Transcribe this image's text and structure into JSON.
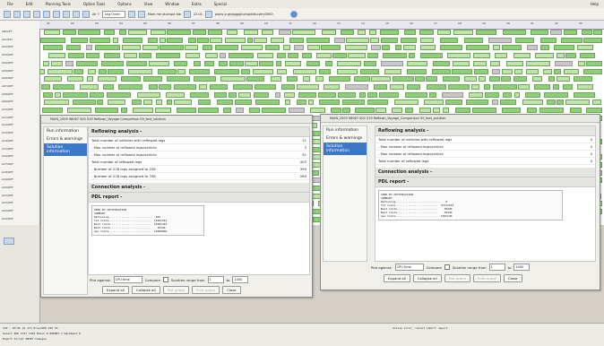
{
  "menu": [
    "File",
    "Edit",
    "Planning Tools",
    "Option Tools",
    "Options",
    "View",
    "Window",
    "Extra",
    "Special",
    "Help"
  ],
  "toolbar": {
    "zoom_label": "Air ?",
    "pairing_label": "Leg Order",
    "sel1": "Mark me ptunspd ble",
    "date_label": "22.01",
    "version_label": "plans p grpsgg/ptunspddd.com/0000"
  },
  "rows": [
    "AN/OPT",
    "A01/EAI",
    "A02/OPT",
    "A03/OPT",
    "A04/OPT",
    "A05/OPT",
    "A06/OPT",
    "A07/OPT",
    "A08/OPT",
    "A09/OPT",
    "A10/OPT",
    "A11/OPT",
    "A12/OPT",
    "A13/OPT",
    "A14/OPT",
    "A15/OPT",
    "A16/OPT",
    "A17/OPT",
    "A18/OPT",
    "A19/OPT",
    "A20/OPT",
    "A21/OPT",
    "A22/OPT",
    "A23/OPT",
    "A24/OPT"
  ],
  "timeline": [
    "01",
    "02",
    "03",
    "04",
    "05",
    "06",
    "07",
    "08",
    "09",
    "10",
    "11",
    "12",
    "13",
    "14",
    "15",
    "16",
    "17",
    "18",
    "19",
    "20",
    "21",
    "22",
    "23"
  ],
  "dialog1": {
    "title": "MAIN_2009 08067 000 019 Reflown_Voyage Comparison 09_test_solution",
    "nav": [
      "Run information",
      "Errors & warnings",
      "Solution information"
    ],
    "reflow_title": "Reflowing analysis -",
    "kv": [
      {
        "k": "Total number of vehicles with reflowed legs",
        "v": "11"
      },
      {
        "k": "- Max number of reflowed legs/vehicle",
        "v": "3"
      },
      {
        "k": "- Max number of reflowed legs/vehicle",
        "v": "91"
      },
      {
        "k": "Total number of reflowed legs",
        "v": "405"
      },
      {
        "k": "- Number of 228 legs assigned to 228",
        "v": "399"
      },
      {
        "k": "- Number of 228 legs assigned to 338",
        "v": "289"
      }
    ],
    "conn_title": "Connection analysis -",
    "pdl_title": "PDL report -",
    "pdl_lines": [
      "SEED BY OPTIMISATION",
      "SUMMARY",
      "Reflowing...........................  402",
      "Tot Costs..........................  16301344",
      "Best Costs.........................  16301444",
      "Best Costs.........................    39440",
      "Gen Costs..........................  11000000"
    ],
    "plot_against": "Plot against:",
    "plot_val": "CPU time",
    "compare": "Compare",
    "range": "Solution range from",
    "range_from": "1",
    "range_to": "1000",
    "to": "to",
    "btns": [
      "Expand all",
      "Collapse all",
      "Plot graph",
      "Print graph",
      "Close"
    ]
  },
  "dialog2": {
    "title": "MAIN_2009 08067 000 019 Reflown_Voyage_Comparison 09_test_solution",
    "nav": [
      "Run information",
      "Errors & warnings",
      "Solution information"
    ],
    "reflow_title": "Reflowing analysis -",
    "kv": [
      {
        "k": "Total number of vehicles with reflowed legs",
        "v": "0"
      },
      {
        "k": "- Max number of reflowed legs/vehicle",
        "v": "0"
      },
      {
        "k": "- Max number of reflowed legs/vehicle",
        "v": "0"
      },
      {
        "k": "Total number of reflowed legs",
        "v": "0"
      }
    ],
    "conn_title": "Connection analysis -",
    "pdl_title": "PDL report -",
    "pdl_lines": [
      "SEED BY OPTIMISATION",
      "SUMMARY",
      "Reflowing...........................    0",
      "Tot Costs..........................  33771534",
      "Best Costs.........................    78440",
      "Best Costs.........................    78440",
      "Gen Costs..........................  1097140"
    ],
    "plot_against": "Plot against:",
    "plot_val": "CPU time",
    "compare": "Compare",
    "range": "Solution range from",
    "range_from": "1",
    "range_to": "1000",
    "to": "to",
    "btns": [
      "Expand all",
      "Collapse all",
      "Plot graph",
      "Print graph",
      "Close"
    ]
  },
  "status": {
    "line1": "102 - 1M  0k 1k      173 Pres/UPD   SIG 16",
    "line2": "Select  ADD 1707 1109 Mount 0 0UPHDT 1 Warmband 8",
    "line3": "Export Script  INSET Changes",
    "right": "Active error, cannot import report"
  }
}
